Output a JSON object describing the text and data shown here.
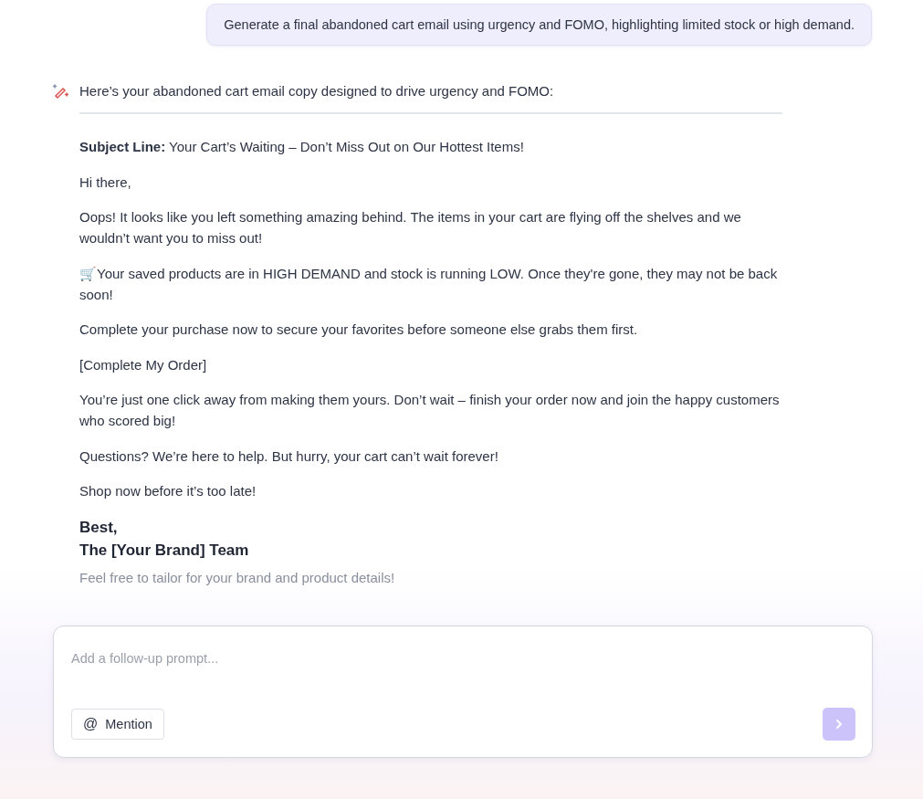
{
  "user_message": {
    "text": "Generate a final abandoned cart email using urgency and FOMO, highlighting limited stock or high demand."
  },
  "reply": {
    "intro": "Here’s your abandoned cart email copy designed to drive urgency and FOMO:",
    "email": {
      "subject": "**Subject Line:** Your Cart’s Waiting – Don’t Miss Out on Our Hottest Items!",
      "paragraphs": [
        "Hi there,",
        "Oops! It looks like you left something amazing behind. The items in your cart are flying off the shelves and we wouldn’t want you to miss out!",
        "🛒Your saved products are in HIGH DEMAND and stock is running LOW. Once they're gone, they may not be back soon!",
        "Complete your purchase now to secure your favorites before someone else grabs them first.",
        "[Complete My Order]",
        "You’re just one click away from making them yours. Don’t wait – finish your order now and join the happy customers who scored big!",
        "Questions? We’re here to help. But hurry, your cart can’t wait forever!",
        "Shop now before it’s too late!"
      ],
      "signoff": [
        "Best,",
        "The [Your Brand] Team"
      ]
    },
    "footnote": "Feel free to tailor for your brand and product details!"
  },
  "composer": {
    "placeholder": "Add a follow-up prompt...",
    "mention_button": {
      "icon": "@",
      "label": "Mention"
    },
    "send_button": {
      "disabled": true
    }
  }
}
